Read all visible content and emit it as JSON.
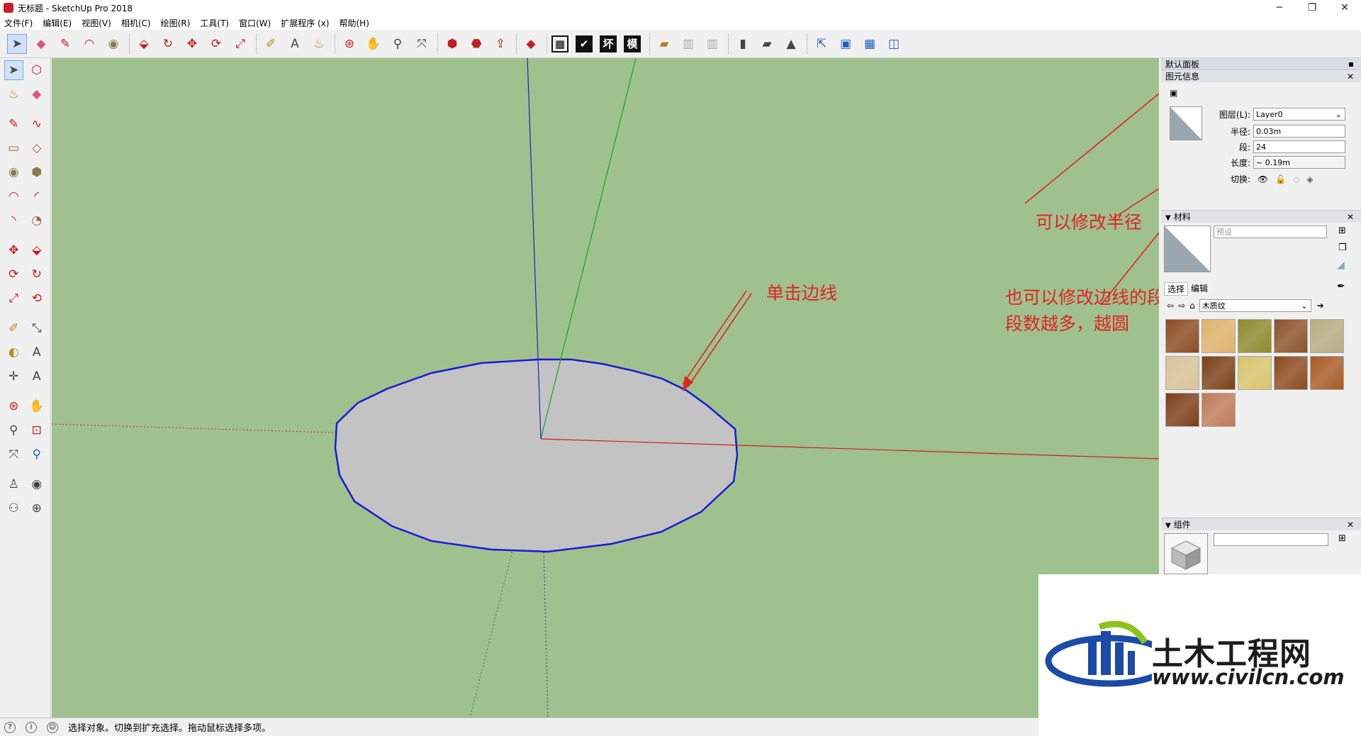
{
  "window": {
    "title": "无标题 - SketchUp Pro 2018",
    "minimize": "─",
    "maximize": "❐",
    "close": "✕"
  },
  "menu": [
    "文件(F)",
    "编辑(E)",
    "视图(V)",
    "相机(C)",
    "绘图(R)",
    "工具(T)",
    "窗口(W)",
    "扩展程序 (x)",
    "帮助(H)"
  ],
  "toolbar": {
    "box1": "▦",
    "box2": "✔",
    "box3": "坏",
    "box4": "模"
  },
  "panel": {
    "title": "默认面板",
    "entity_info": {
      "title": "图元信息",
      "layer_label": "图层(L):",
      "layer_value": "Layer0",
      "radius_label": "半径:",
      "radius_value": "0.03m",
      "segments_label": "段:",
      "segments_value": "24",
      "length_label": "长度:",
      "length_value": "~ 0.19m",
      "toggle_label": "切换:"
    },
    "materials": {
      "title": "材料",
      "name_placeholder": "预设",
      "tab_select": "选择",
      "tab_edit": "编辑",
      "library": "木质纹",
      "swatch_colors": [
        "#8a4a1e",
        "#e0b36a",
        "#8a8a2a",
        "#8c5128",
        "#b8ac80",
        "#d8c39a",
        "#7a3f14",
        "#d9c56a",
        "#8b4a1c",
        "#a85a22",
        "#7c3d18",
        "#c07a58"
      ]
    },
    "components": {
      "title": "组件"
    }
  },
  "status": {
    "text": "选择对象。切换到扩充选择。拖动鼠标选择多项。"
  },
  "annotations": {
    "click_edge": "单击边线",
    "modify_radius": "可以修改半径",
    "modify_segments_1": "也可以修改边线的段数",
    "modify_segments_2": "段数越多，越圆"
  },
  "watermark": {
    "name": "土木工程网",
    "url": "www.civilcn.com"
  },
  "colors": {
    "viewport": "#9fc18e",
    "annotation": "#e02424",
    "circle_edge": "#1a1ad6",
    "face": "#c3c3c3"
  }
}
